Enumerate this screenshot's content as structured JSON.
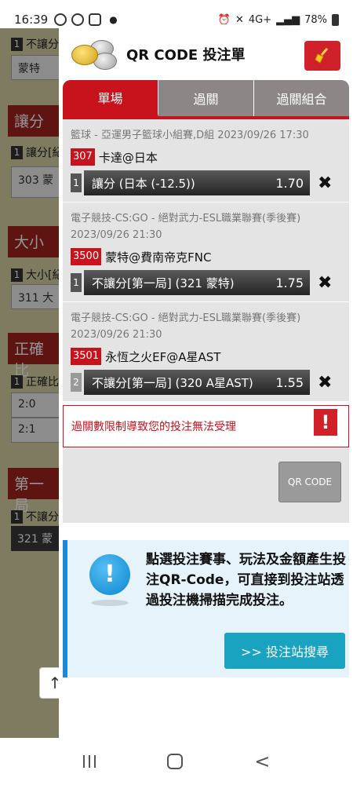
{
  "status_bar": {
    "time": "16:39",
    "battery": "78%",
    "network": "4G+"
  },
  "background": {
    "rows": [
      {
        "num": "1",
        "label": "不讓分"
      },
      {
        "box": "蒙特"
      },
      {
        "section": "讓分"
      },
      {
        "num": "1",
        "label": "讓分[紀"
      },
      {
        "box": "303 蒙"
      },
      {
        "section": "大小"
      },
      {
        "num": "1",
        "label": "大小[紀"
      },
      {
        "box": "311 大"
      },
      {
        "section": "正確比"
      },
      {
        "num": "1",
        "label": "正確比"
      },
      {
        "box": "2:0"
      },
      {
        "box": "2:1"
      },
      {
        "section": "第一局"
      },
      {
        "num": "1",
        "label": "不讓分"
      },
      {
        "box": "321 蒙"
      }
    ]
  },
  "panel": {
    "title": "QR CODE 投注單",
    "tabs": [
      "單場",
      "過關",
      "過關組合"
    ],
    "active_tab": "單場",
    "bets": [
      {
        "meta_line1": "籃球 - 亞運男子籃球小組賽,D組 2023/09/26 17:30",
        "meta_line2": "",
        "code": "307",
        "teams": "卡達@日本",
        "index": "1",
        "selection": "讓分 (日本 (-12.5))",
        "odds": "1.70"
      },
      {
        "meta_line1": "電子競技-CS:GO - 絕對武力-ESL職業聯賽(季後賽)",
        "meta_line2": "2023/09/26 21:30",
        "code": "3500",
        "teams": "蒙特@費南帝克FNC",
        "index": "1",
        "selection": "不讓分[第一局] (321 蒙特)",
        "odds": "1.75"
      },
      {
        "meta_line1": "電子競技-CS:GO - 絕對武力-ESL職業聯賽(季後賽)",
        "meta_line2": "2023/09/26 21:30",
        "code": "3501",
        "teams": "永恆之火EF@A星AST",
        "index": "2",
        "selection": "不讓分[第一局] (320 A星AST)",
        "odds": "1.55"
      }
    ],
    "error_message": "過關數限制導致您的投注無法受理",
    "qr_button": "QR CODE",
    "info_text": "點選投注賽事、玩法及金額產生投注QR-Code，可直接到投注站透過投注機掃描完成投注。",
    "search_button": ">> 投注站搜尋"
  }
}
